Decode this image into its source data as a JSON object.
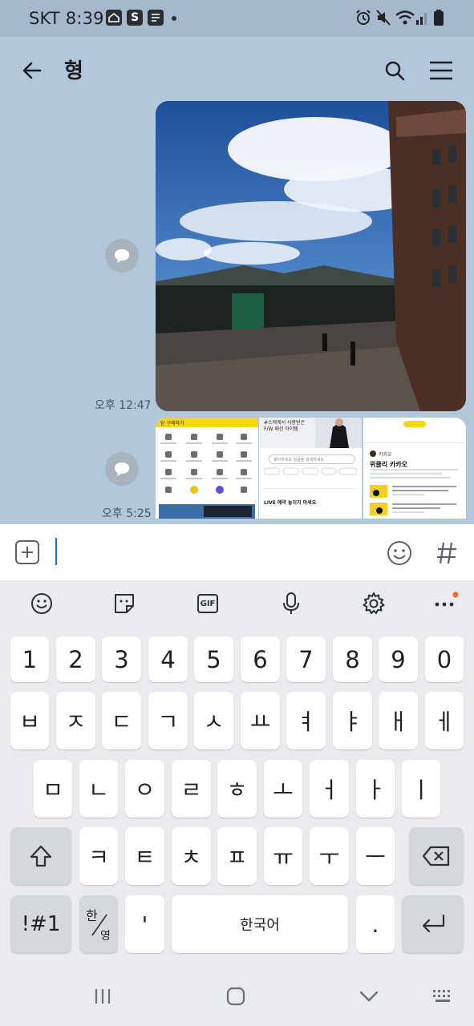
{
  "status": {
    "carrier_time": "SKT 8:39",
    "s_badge": "S"
  },
  "header": {
    "title": "형"
  },
  "messages": [
    {
      "time": "오후 12:47",
      "kind": "photo"
    },
    {
      "time": "오후 5:25",
      "kind": "photo-group",
      "thumb_texts": {
        "banner": "닫  구매하기",
        "mid_title": "#스케케서 사랑받은 F/W 패션 아이템",
        "mid_search": "찾아주세요 상품을 검색하세요",
        "mid_live": "LIVE 예약 놓치지 마세요",
        "right_title": "위클리 카카오",
        "right_sub": "카카오"
      }
    }
  ],
  "input": {
    "value": ""
  },
  "keyboard": {
    "numbers": [
      "1",
      "2",
      "3",
      "4",
      "5",
      "6",
      "7",
      "8",
      "9",
      "0"
    ],
    "row1": [
      "ㅂ",
      "ㅈ",
      "ㄷ",
      "ㄱ",
      "ㅅ",
      "ㅛ",
      "ㅕ",
      "ㅑ",
      "ㅐ",
      "ㅔ"
    ],
    "row2": [
      "ㅁ",
      "ㄴ",
      "ㅇ",
      "ㄹ",
      "ㅎ",
      "ㅗ",
      "ㅓ",
      "ㅏ",
      "ㅣ"
    ],
    "row3": [
      "ㅋ",
      "ㅌ",
      "ㅊ",
      "ㅍ",
      "ㅠ",
      "ㅜ",
      "ㅡ"
    ],
    "symbols_label": "!#1",
    "lang_top": "한",
    "lang_bottom": "영",
    "apostrophe": "'",
    "space_label": "한국어",
    "period": ".",
    "toolbar_gif": "GIF"
  },
  "colors": {
    "chat_bg": "#b2c7da",
    "accent_dot": "#f36b1c",
    "cursor": "#1a76c9"
  }
}
